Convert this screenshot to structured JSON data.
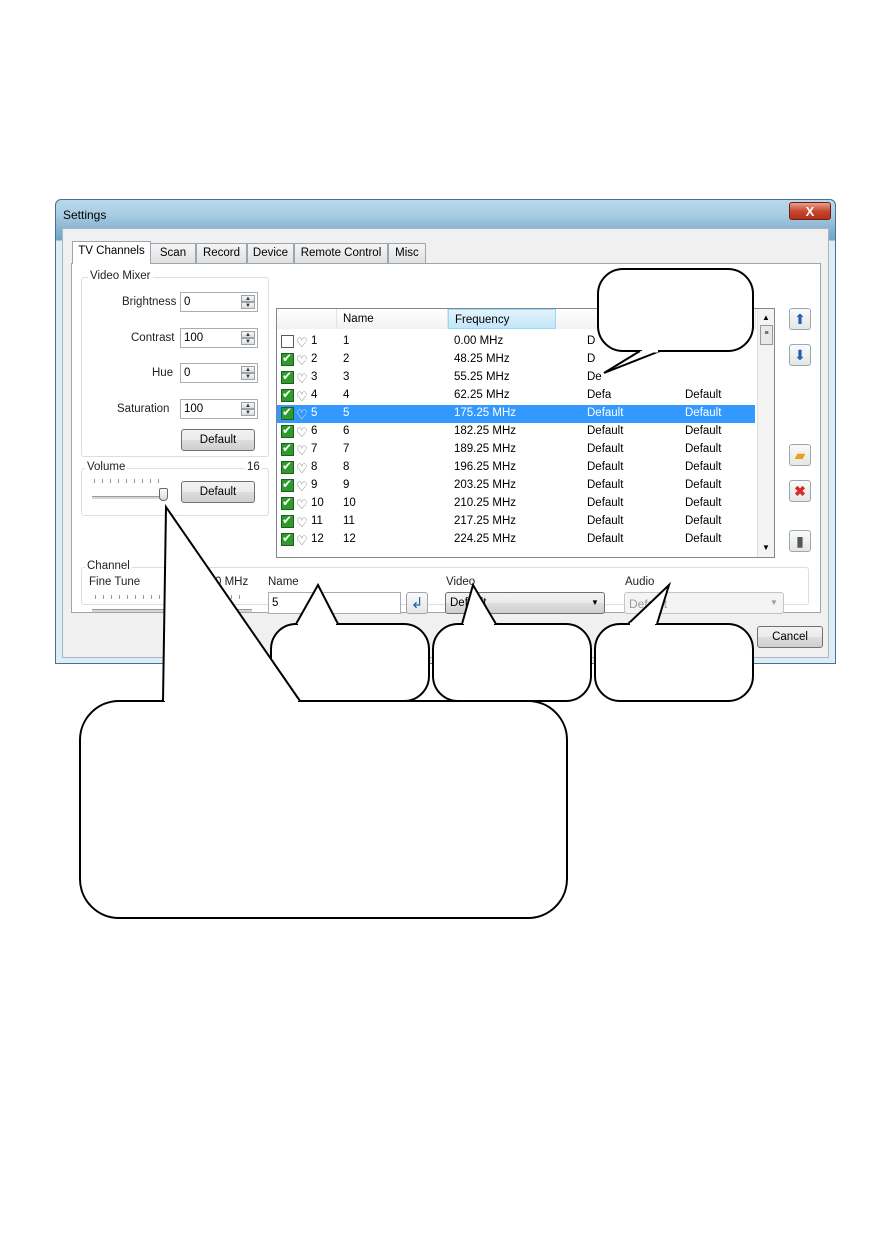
{
  "window": {
    "title": "Settings",
    "close_label": "X"
  },
  "tabs": [
    {
      "label": "TV Channels"
    },
    {
      "label": "Scan"
    },
    {
      "label": "Record"
    },
    {
      "label": "Device"
    },
    {
      "label": "Remote Control"
    },
    {
      "label": "Misc"
    }
  ],
  "video_mixer": {
    "title": "Video Mixer",
    "brightness": {
      "label": "Brightness",
      "value": "0"
    },
    "contrast": {
      "label": "Contrast",
      "value": "100"
    },
    "hue": {
      "label": "Hue",
      "value": "0"
    },
    "saturation": {
      "label": "Saturation",
      "value": "100"
    },
    "default_label": "Default"
  },
  "volume": {
    "title": "Volume",
    "value": "16",
    "default_label": "Default",
    "level": 0.95
  },
  "channel_list": {
    "columns": [
      "Name",
      "Frequency"
    ],
    "rows": [
      {
        "num": "1",
        "name": "1",
        "freq": "0.00 MHz",
        "video": "D",
        "audio": "",
        "checked": false,
        "selected": false
      },
      {
        "num": "2",
        "name": "2",
        "freq": "48.25 MHz",
        "video": "D",
        "audio": "",
        "checked": true,
        "selected": false
      },
      {
        "num": "3",
        "name": "3",
        "freq": "55.25 MHz",
        "video": "De",
        "audio": "",
        "checked": true,
        "selected": false
      },
      {
        "num": "4",
        "name": "4",
        "freq": "62.25 MHz",
        "video": "Defa",
        "audio": "Default",
        "checked": true,
        "selected": false
      },
      {
        "num": "5",
        "name": "5",
        "freq": "175.25 MHz",
        "video": "Default",
        "audio": "Default",
        "checked": true,
        "selected": true
      },
      {
        "num": "6",
        "name": "6",
        "freq": "182.25 MHz",
        "video": "Default",
        "audio": "Default",
        "checked": true,
        "selected": false
      },
      {
        "num": "7",
        "name": "7",
        "freq": "189.25 MHz",
        "video": "Default",
        "audio": "Default",
        "checked": true,
        "selected": false
      },
      {
        "num": "8",
        "name": "8",
        "freq": "196.25 MHz",
        "video": "Default",
        "audio": "Default",
        "checked": true,
        "selected": false
      },
      {
        "num": "9",
        "name": "9",
        "freq": "203.25 MHz",
        "video": "Default",
        "audio": "Default",
        "checked": true,
        "selected": false
      },
      {
        "num": "10",
        "name": "10",
        "freq": "210.25 MHz",
        "video": "Default",
        "audio": "Default",
        "checked": true,
        "selected": false
      },
      {
        "num": "11",
        "name": "11",
        "freq": "217.25 MHz",
        "video": "Default",
        "audio": "Default",
        "checked": true,
        "selected": false
      },
      {
        "num": "12",
        "name": "12",
        "freq": "224.25 MHz",
        "video": "Default",
        "audio": "Default",
        "checked": true,
        "selected": false
      }
    ]
  },
  "channel": {
    "title": "Channel",
    "fine_tune_label": "Fine Tune",
    "fine_tune_value": "0 MHz",
    "name_label": "Name",
    "name_value": "5",
    "video_label": "Video",
    "video_value": "Default",
    "audio_label": "Audio",
    "audio_value": "Default"
  },
  "footer": {
    "cancel_label": "Cancel"
  },
  "icons": {
    "up": "arrow-up-icon",
    "down": "arrow-down-icon",
    "open": "folder-open-icon",
    "delete": "delete-x-icon",
    "clear": "trash-icon",
    "apply": "enter-arrow-icon"
  },
  "colors": {
    "selection": "#3399ff",
    "check": "#2e9b2e",
    "title_bar": "#8bb6d4"
  }
}
